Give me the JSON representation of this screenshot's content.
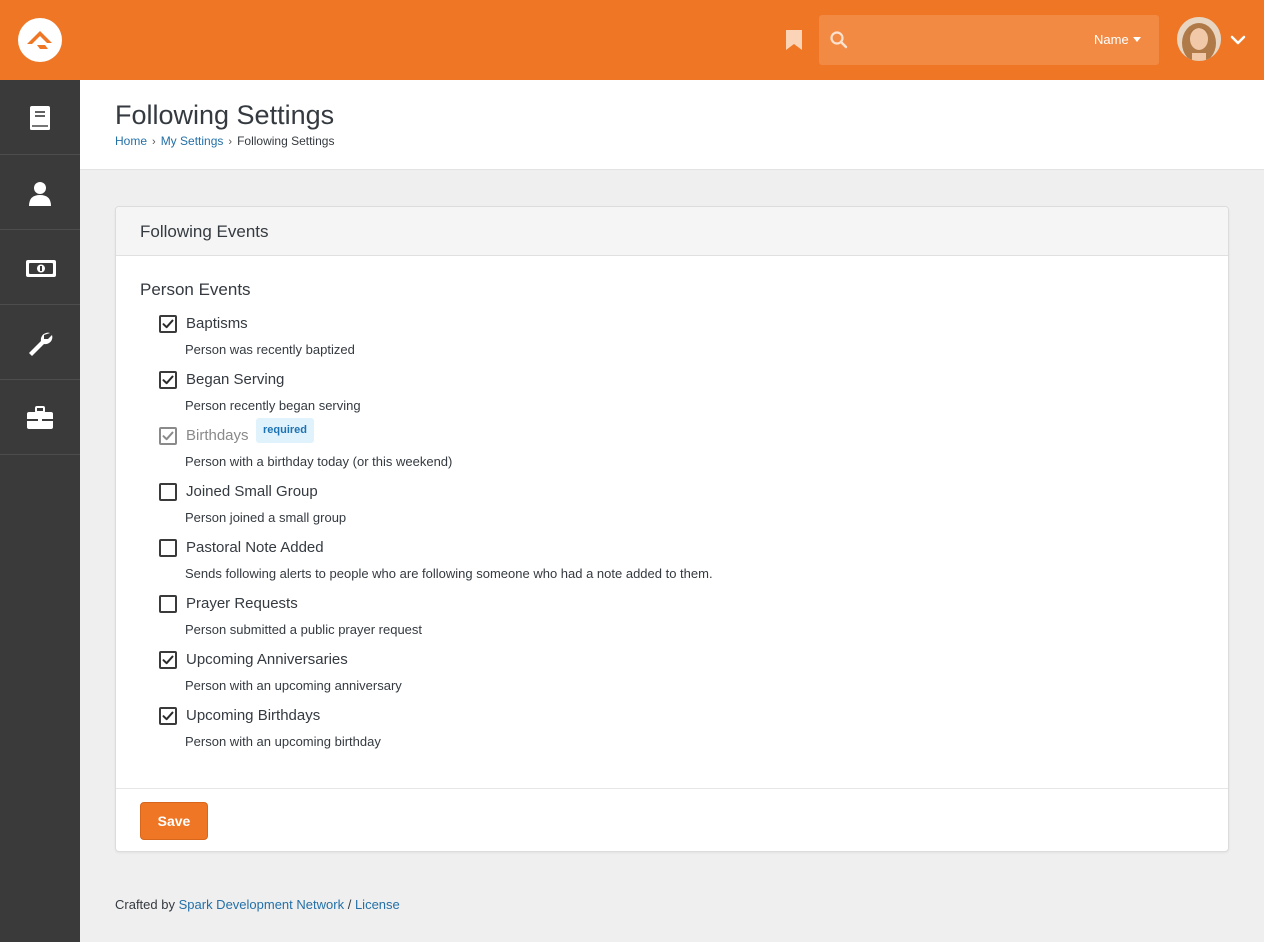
{
  "colors": {
    "brand": "#ee7625",
    "sidebar": "#3a3a3a",
    "link": "#2470a7",
    "badge_bg": "#e0f2fc",
    "badge_text": "#1c73b4"
  },
  "header": {
    "search": {
      "placeholder": "",
      "type_label": "Name"
    },
    "icons": [
      "rock-logo-icon",
      "bookmark-icon",
      "search-icon",
      "chevron-down-icon"
    ]
  },
  "sidebar": {
    "items": [
      {
        "icon": "book-icon"
      },
      {
        "icon": "user-icon"
      },
      {
        "icon": "money-icon"
      },
      {
        "icon": "wrench-icon"
      },
      {
        "icon": "briefcase-icon"
      }
    ]
  },
  "page": {
    "title": "Following Settings",
    "breadcrumb": [
      "Home",
      "My Settings",
      "Following Settings"
    ]
  },
  "panel": {
    "title": "Following Events",
    "section_title": "Person Events",
    "save_label": "Save",
    "events": [
      {
        "label": "Baptisms",
        "description": "Person was recently baptized",
        "checked": true
      },
      {
        "label": "Began Serving",
        "description": "Person recently began serving",
        "checked": true
      },
      {
        "label": "Birthdays",
        "description": "Person with a birthday today (or this weekend)",
        "checked": true,
        "disabled": true,
        "badge": "required"
      },
      {
        "label": "Joined Small Group",
        "description": "Person joined a small group",
        "checked": false
      },
      {
        "label": "Pastoral Note Added",
        "description": "Sends following alerts to people who are following someone who had a note added to them.",
        "checked": false
      },
      {
        "label": "Prayer Requests",
        "description": "Person submitted a public prayer request",
        "checked": false
      },
      {
        "label": "Upcoming Anniversaries",
        "description": "Person with an upcoming anniversary",
        "checked": true
      },
      {
        "label": "Upcoming Birthdays",
        "description": "Person with an upcoming birthday",
        "checked": true
      }
    ]
  },
  "footer": {
    "prefix": "Crafted by",
    "org_link": "Spark Development Network",
    "separator": "/",
    "license_link": "License"
  }
}
